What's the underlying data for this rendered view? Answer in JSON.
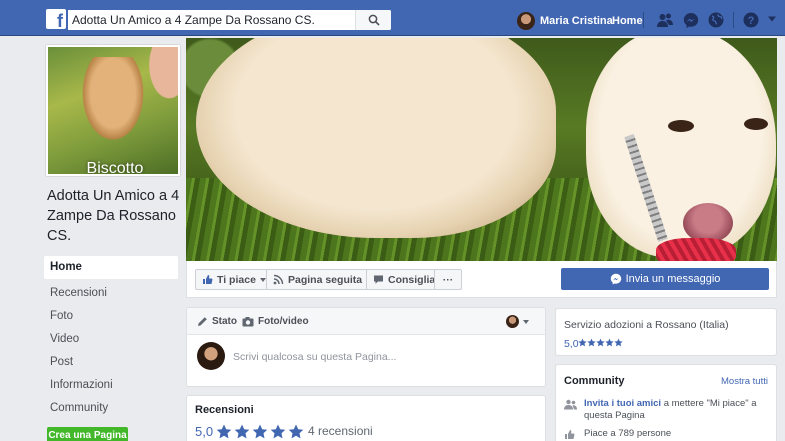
{
  "search": {
    "value": "Adotta Un Amico a 4 Zampe Da Rossano CS."
  },
  "topnav": {
    "profile_name": "Maria Cristina",
    "home_label": "Home"
  },
  "colors": {
    "fb_blue": "#4267b2",
    "green": "#42b72a",
    "link": "#4267b2"
  },
  "icons": {
    "logo": "facebook-logo-icon",
    "search": "magnifier-icon",
    "friends": "friends-icon",
    "messenger": "messenger-icon",
    "notifications": "globe-icon",
    "help": "question-icon"
  },
  "page": {
    "profile_caption": "Biscotto",
    "name": "Adotta Un Amico a 4 Zampe Da Rossano CS."
  },
  "left_nav": {
    "items": [
      "Home",
      "Recensioni",
      "Foto",
      "Video",
      "Post",
      "Informazioni",
      "Community"
    ],
    "create_page": "Crea una Pagina"
  },
  "actions": {
    "like": "Ti piace",
    "following": "Pagina seguita",
    "share": "Consiglia",
    "more": "···",
    "message": "Invia un messaggio"
  },
  "composer": {
    "status_tab": "Stato",
    "photo_tab": "Foto/video",
    "placeholder": "Scrivi qualcosa su questa Pagina..."
  },
  "reviews": {
    "title": "Recensioni",
    "score": "5,0",
    "stars": 5,
    "count_text": "4 recensioni"
  },
  "info": {
    "category": "Servizio adozioni a Rossano (Italia)",
    "score": "5,0",
    "stars": 5
  },
  "community": {
    "title": "Community",
    "see_all": "Mostra tutti",
    "invite_link": "Invita i tuoi amici",
    "invite_rest": " a mettere \"Mi piace\" a questa Pagina",
    "likes_text": "Piace a 789 persone"
  }
}
